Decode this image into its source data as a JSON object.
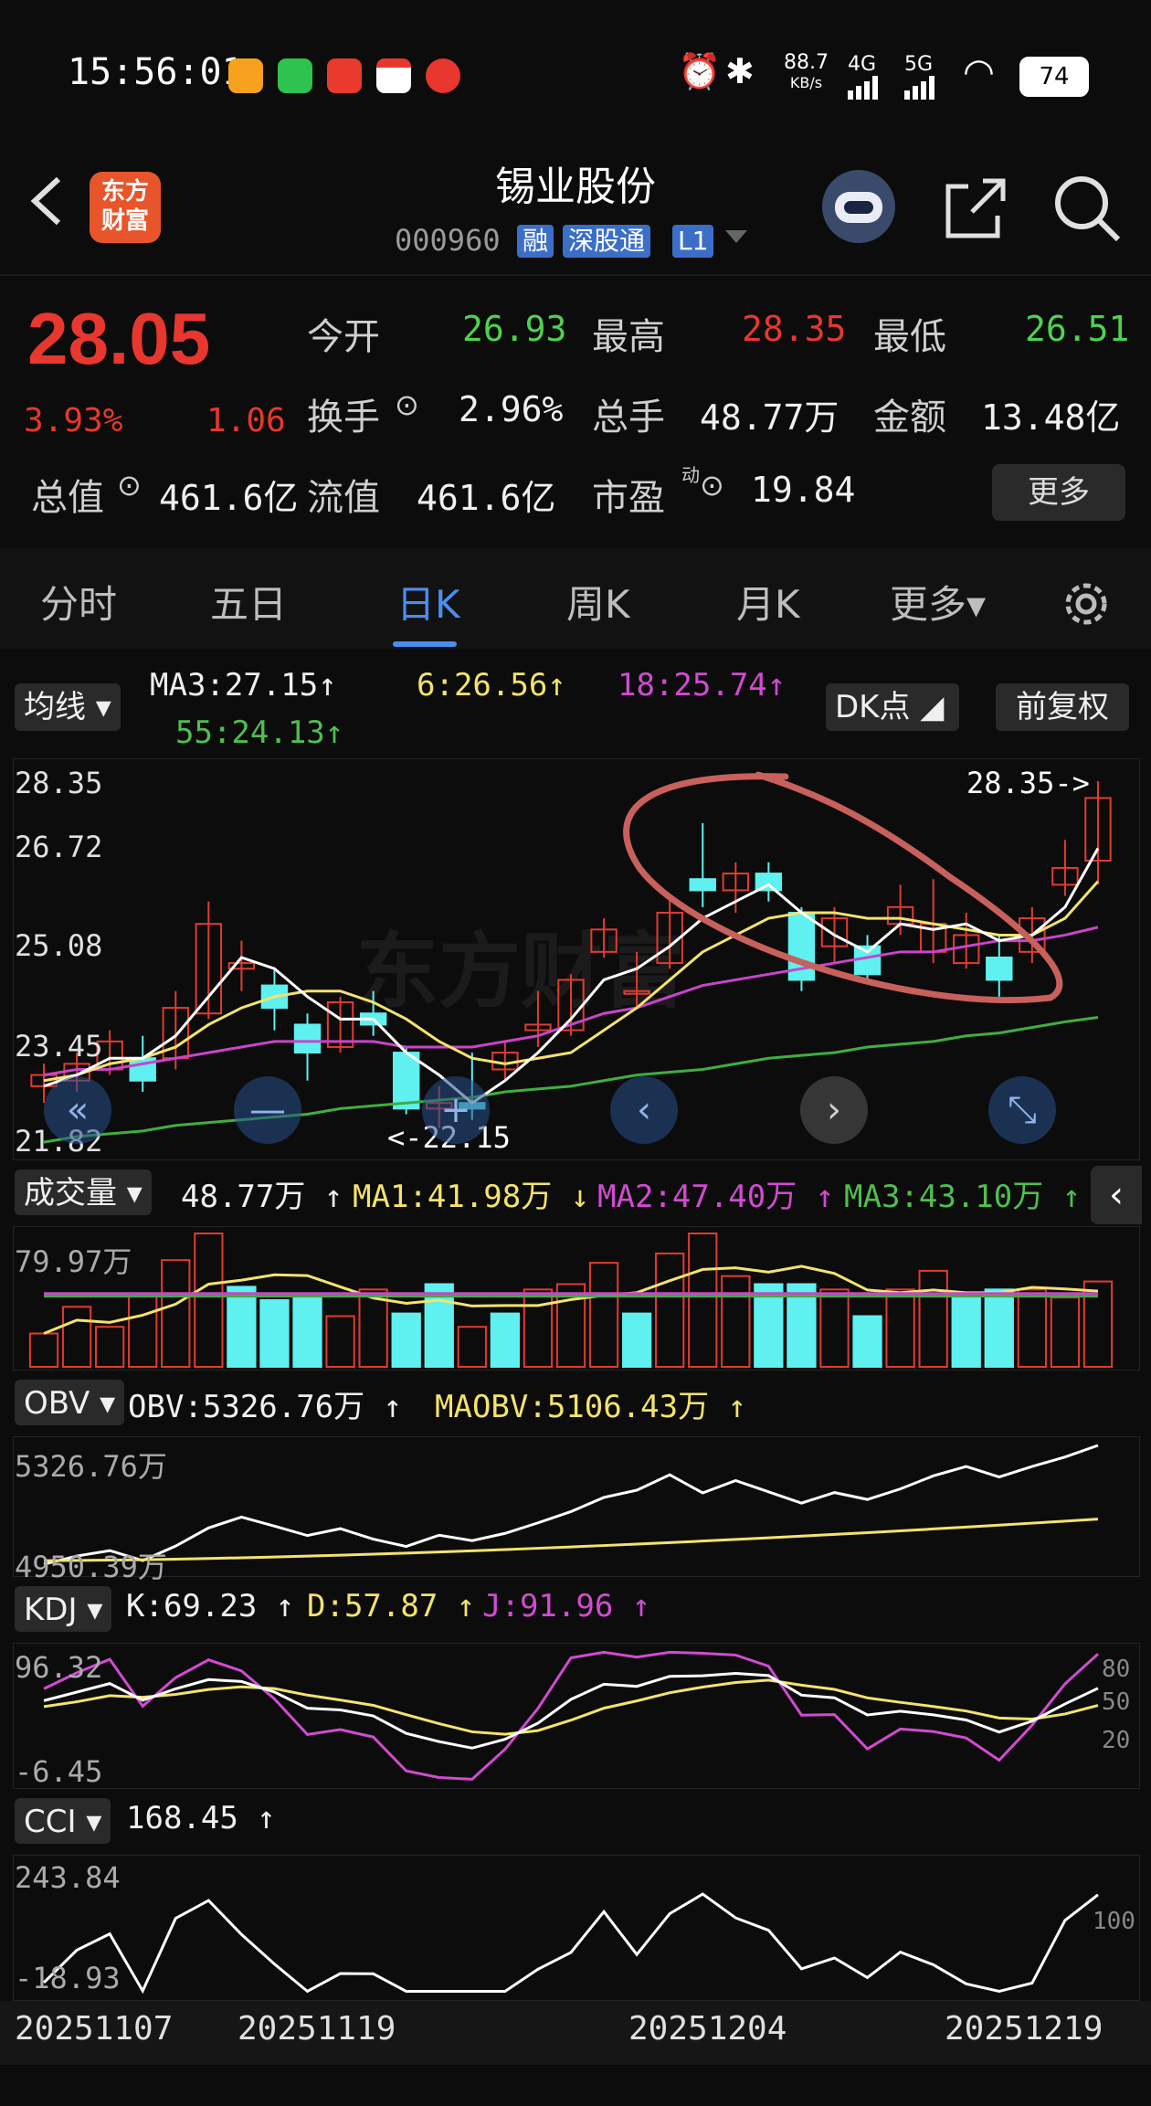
{
  "status_bar": {
    "time": "15:56:01",
    "net_speed": "88.7",
    "net_unit": "KB/s",
    "signal1": "4G",
    "signal2": "5G",
    "battery": "74"
  },
  "header": {
    "logo_line1": "东方",
    "logo_line2": "财富",
    "stock_name": "锡业股份",
    "stock_code": "000960",
    "tags": [
      "融",
      "深股通",
      "L1"
    ]
  },
  "quote": {
    "price": "28.05",
    "change_pct": "3.93%",
    "change_amt": "1.06",
    "open_label": "今开",
    "open": "26.93",
    "high_label": "最高",
    "high": "28.35",
    "low_label": "最低",
    "low": "26.51",
    "turnover_label": "换手",
    "turnover": "2.96%",
    "volume_label": "总手",
    "volume": "48.77万",
    "amount_label": "金额",
    "amount": "13.48亿",
    "mktcap_label": "总值",
    "mktcap": "461.6亿",
    "float_label": "流值",
    "float_cap": "461.6亿",
    "pe_label": "市盈",
    "pe_sup": "动",
    "pe": "19.84",
    "more_label": "更多"
  },
  "tabs": {
    "items": [
      "分时",
      "五日",
      "日K",
      "周K",
      "月K",
      "更多▾"
    ],
    "active": "日K"
  },
  "kline": {
    "ma_selector": "均线",
    "ma3": "MA3:27.15",
    "ma6": "6:26.56",
    "ma18": "18:25.74",
    "ma55": "55:24.13",
    "dk_button": "DK点",
    "adjust_button": "前复权",
    "y_labels": [
      "28.35",
      "26.72",
      "25.08",
      "23.45",
      "21.82"
    ],
    "high_marker": "28.35->",
    "low_marker": "<-22.15",
    "watermark": "东方财富"
  },
  "volume": {
    "selector": "成交量",
    "value": "48.77万",
    "ma1": "MA1:41.98万",
    "ma2": "MA2:47.40万",
    "ma3": "MA3:43.10万",
    "y_label": "79.97万"
  },
  "obv": {
    "selector": "OBV",
    "value": "OBV:5326.76万",
    "ma": "MAOBV:5106.43万",
    "y_top": "5326.76万",
    "y_bottom": "4950.39万"
  },
  "kdj": {
    "selector": "KDJ",
    "k": "K:69.23",
    "d": "D:57.87",
    "j": "J:91.96",
    "y_top": "96.32",
    "y_bottom": "-6.45",
    "levels": [
      "80",
      "50",
      "20"
    ]
  },
  "cci": {
    "selector": "CCI",
    "value": "168.45",
    "y_top": "243.84",
    "y_bottom": "-18.93",
    "level": "100"
  },
  "dates": [
    "20251107",
    "20251119",
    "20251204",
    "20251219"
  ],
  "chart_data": {
    "type": "candlestick",
    "title": "锡业股份 日K",
    "ylim": [
      21.82,
      28.35
    ],
    "candles": [
      {
        "o": 22.9,
        "c": 23.1,
        "h": 23.3,
        "l": 22.6
      },
      {
        "o": 23.0,
        "c": 23.3,
        "h": 23.5,
        "l": 22.8
      },
      {
        "o": 23.2,
        "c": 23.7,
        "h": 23.9,
        "l": 23.1
      },
      {
        "o": 23.4,
        "c": 23.0,
        "h": 23.8,
        "l": 22.8
      },
      {
        "o": 23.4,
        "c": 24.3,
        "h": 24.6,
        "l": 23.2
      },
      {
        "o": 24.2,
        "c": 25.8,
        "h": 26.2,
        "l": 24.1
      },
      {
        "o": 25.0,
        "c": 25.1,
        "h": 25.5,
        "l": 24.6
      },
      {
        "o": 24.7,
        "c": 24.3,
        "h": 25.0,
        "l": 23.9
      },
      {
        "o": 24.0,
        "c": 23.5,
        "h": 24.2,
        "l": 23.0
      },
      {
        "o": 23.6,
        "c": 24.4,
        "h": 24.5,
        "l": 23.5
      },
      {
        "o": 24.2,
        "c": 24.0,
        "h": 24.6,
        "l": 23.8
      },
      {
        "o": 23.5,
        "c": 22.5,
        "h": 23.6,
        "l": 22.4
      },
      {
        "o": 22.5,
        "c": 22.6,
        "h": 22.9,
        "l": 22.15
      },
      {
        "o": 22.6,
        "c": 22.5,
        "h": 23.5,
        "l": 22.3
      },
      {
        "o": 23.2,
        "c": 23.5,
        "h": 23.7,
        "l": 23.0
      },
      {
        "o": 23.9,
        "c": 24.0,
        "h": 24.6,
        "l": 23.6
      },
      {
        "o": 23.9,
        "c": 24.8,
        "h": 24.9,
        "l": 23.8
      },
      {
        "o": 25.3,
        "c": 25.7,
        "h": 25.9,
        "l": 25.2
      },
      {
        "o": 24.6,
        "c": 24.6,
        "h": 25.3,
        "l": 24.3
      },
      {
        "o": 25.1,
        "c": 26.0,
        "h": 26.3,
        "l": 25.0
      },
      {
        "o": 26.6,
        "c": 26.4,
        "h": 27.6,
        "l": 26.1
      },
      {
        "o": 26.4,
        "c": 26.7,
        "h": 26.9,
        "l": 26.0
      },
      {
        "o": 26.7,
        "c": 26.4,
        "h": 26.9,
        "l": 26.2
      },
      {
        "o": 26.0,
        "c": 24.8,
        "h": 26.1,
        "l": 24.6
      },
      {
        "o": 25.4,
        "c": 25.9,
        "h": 26.1,
        "l": 25.1
      },
      {
        "o": 25.4,
        "c": 24.9,
        "h": 25.6,
        "l": 24.8
      },
      {
        "o": 25.8,
        "c": 26.1,
        "h": 26.5,
        "l": 25.6
      },
      {
        "o": 25.3,
        "c": 25.8,
        "h": 26.6,
        "l": 25.1
      },
      {
        "o": 25.1,
        "c": 25.6,
        "h": 26.0,
        "l": 25.0
      },
      {
        "o": 25.2,
        "c": 24.8,
        "h": 25.6,
        "l": 24.5
      },
      {
        "o": 25.3,
        "c": 25.9,
        "h": 26.1,
        "l": 25.1
      },
      {
        "o": 26.5,
        "c": 26.8,
        "h": 27.3,
        "l": 26.3
      },
      {
        "o": 26.93,
        "c": 28.05,
        "h": 28.35,
        "l": 26.51
      }
    ],
    "ma3": [
      22.9,
      23.1,
      23.4,
      23.4,
      23.8,
      24.5,
      25.2,
      25.0,
      24.5,
      24.1,
      24.1,
      23.5,
      23.1,
      22.6,
      23.0,
      23.5,
      24.1,
      24.8,
      25.0,
      25.4,
      25.9,
      26.2,
      26.5,
      26.0,
      25.6,
      25.3,
      25.8,
      25.7,
      25.8,
      25.5,
      25.6,
      26.1,
      27.15
    ],
    "ma6": [
      23.0,
      23.1,
      23.3,
      23.4,
      23.6,
      24.0,
      24.3,
      24.5,
      24.6,
      24.6,
      24.4,
      24.1,
      23.7,
      23.4,
      23.3,
      23.4,
      23.5,
      23.9,
      24.3,
      24.8,
      25.3,
      25.6,
      25.9,
      26.0,
      26.0,
      25.9,
      25.9,
      25.8,
      25.7,
      25.6,
      25.6,
      25.9,
      26.56
    ],
    "ma18": [
      23.1,
      23.2,
      23.2,
      23.3,
      23.4,
      23.5,
      23.6,
      23.7,
      23.7,
      23.7,
      23.7,
      23.6,
      23.6,
      23.6,
      23.7,
      23.8,
      24.0,
      24.2,
      24.3,
      24.5,
      24.7,
      24.8,
      24.9,
      25.0,
      25.1,
      25.2,
      25.3,
      25.3,
      25.4,
      25.5,
      25.5,
      25.6,
      25.74
    ],
    "ma55": [
      21.9,
      22.0,
      22.05,
      22.1,
      22.2,
      22.25,
      22.3,
      22.35,
      22.4,
      22.5,
      22.55,
      22.6,
      22.65,
      22.7,
      22.8,
      22.85,
      22.9,
      23.0,
      23.1,
      23.15,
      23.2,
      23.3,
      23.4,
      23.45,
      23.5,
      23.6,
      23.65,
      23.7,
      23.8,
      23.85,
      23.95,
      24.05,
      24.13
    ],
    "volume": [
      25,
      45,
      30,
      55,
      80,
      100,
      60,
      50,
      52,
      38,
      58,
      40,
      62,
      30,
      40,
      58,
      62,
      78,
      40,
      85,
      100,
      68,
      62,
      62,
      58,
      38,
      58,
      72,
      52,
      58,
      58,
      52,
      64
    ],
    "volume_up": [
      true,
      true,
      true,
      true,
      true,
      true,
      false,
      false,
      false,
      true,
      true,
      false,
      false,
      true,
      false,
      true,
      true,
      true,
      false,
      true,
      true,
      true,
      false,
      false,
      true,
      false,
      true,
      true,
      false,
      false,
      true,
      true,
      true
    ]
  }
}
